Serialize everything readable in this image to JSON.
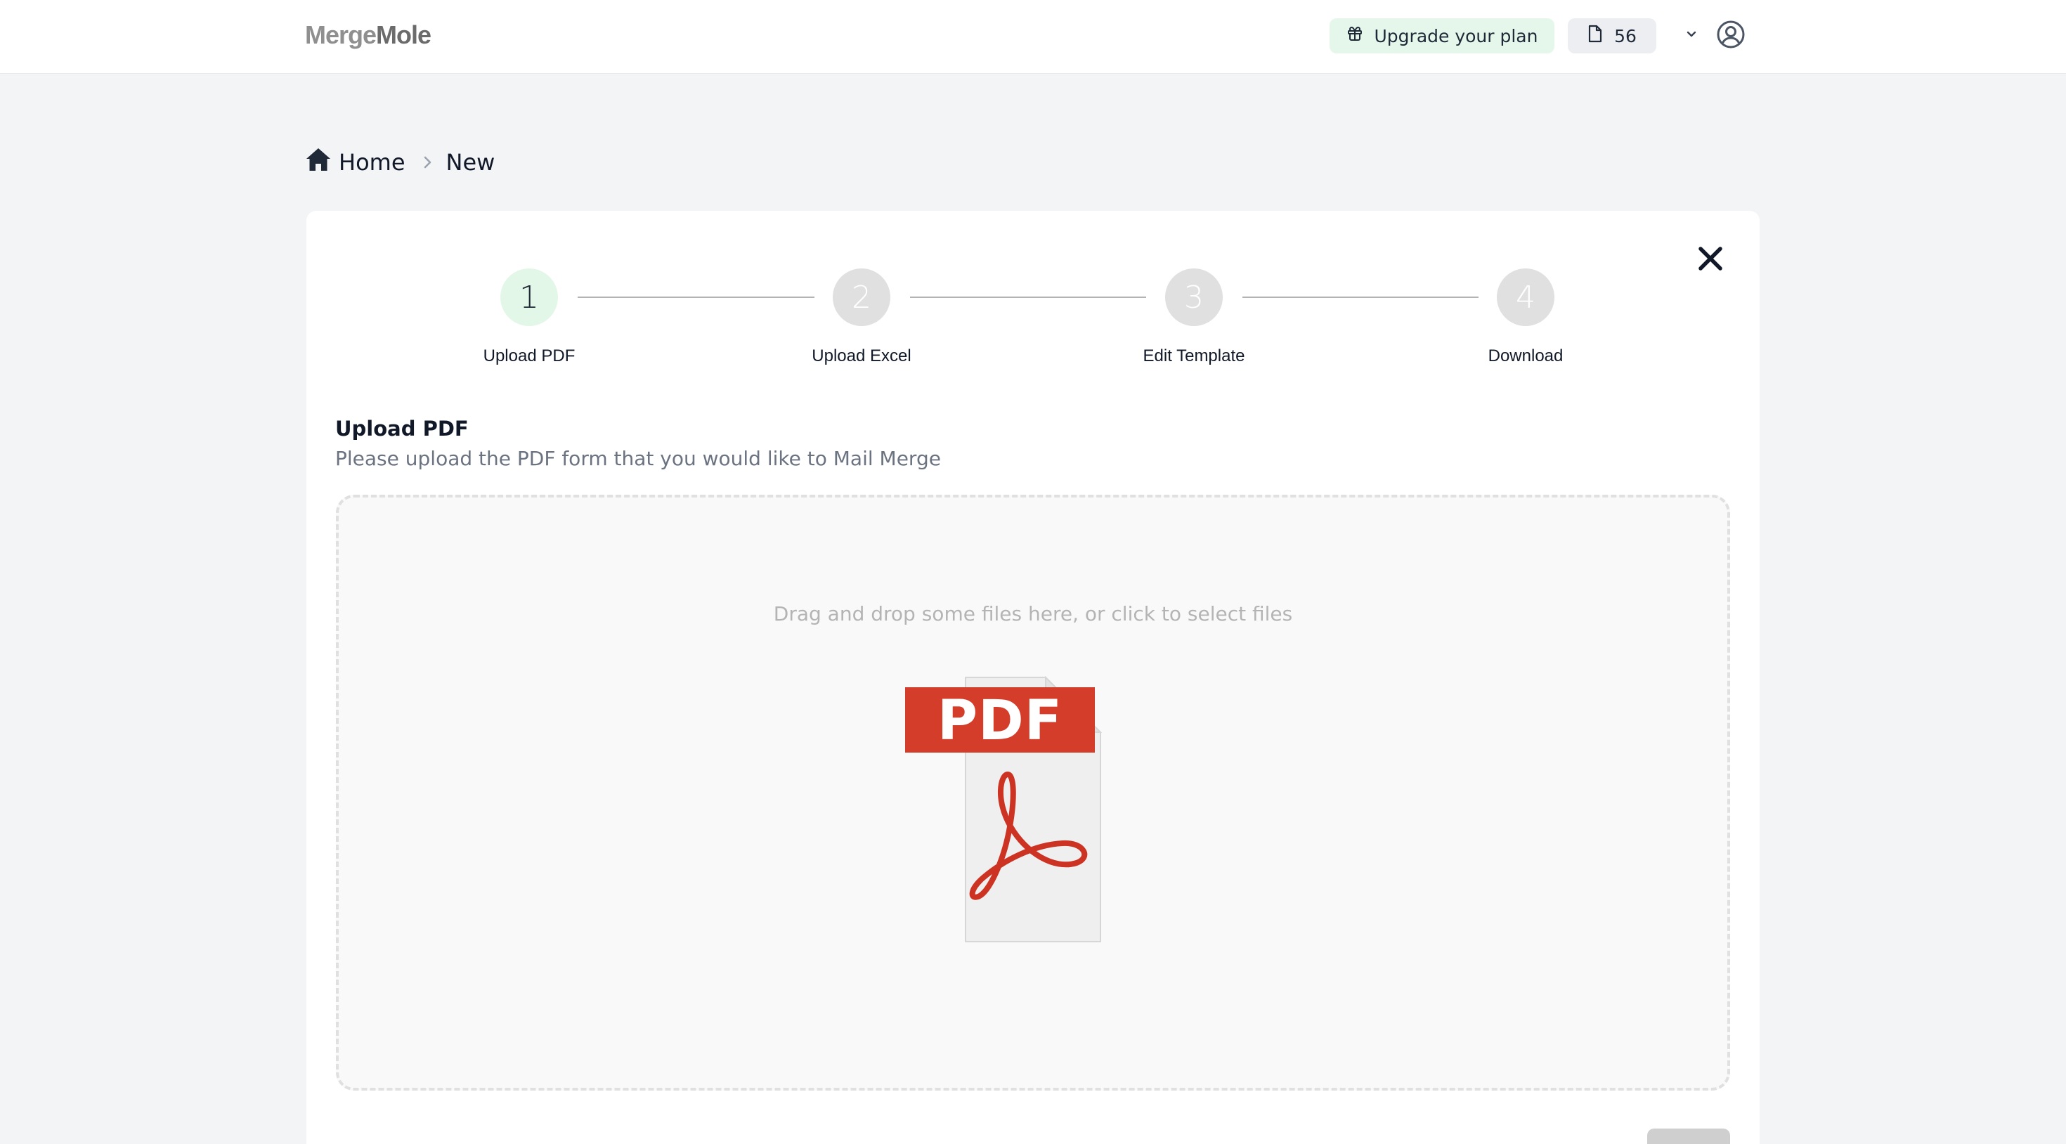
{
  "header": {
    "logo_part1": "Merge",
    "logo_part2": "Mole",
    "upgrade_label": "Upgrade your plan",
    "credits_count": "56"
  },
  "breadcrumb": {
    "home": "Home",
    "current": "New"
  },
  "stepper": {
    "steps": [
      {
        "number": "1",
        "label": "Upload PDF",
        "state": "active"
      },
      {
        "number": "2",
        "label": "Upload Excel",
        "state": "pending"
      },
      {
        "number": "3",
        "label": "Edit Template",
        "state": "pending"
      },
      {
        "number": "4",
        "label": "Download",
        "state": "pending"
      }
    ]
  },
  "upload": {
    "title": "Upload PDF",
    "description": "Please upload the PDF form that you would like to Mail Merge",
    "dropzone_hint": "Drag and drop some files here, or click to select files",
    "pdf_icon_text": "PDF"
  },
  "icons": {
    "upgrade": "gift-icon",
    "credits": "document-icon",
    "menu": "chevron-down-icon",
    "user": "user-circle-icon",
    "home": "home-icon",
    "separator": "chevron-right-icon",
    "close": "close-icon",
    "file": "pdf-file-icon"
  },
  "colors": {
    "accent_green_bg": "#e4f7ea",
    "active_step_bg": "#e3f7e9",
    "pending_step_bg": "#e0e0e0",
    "pdf_red": "#d33d2a",
    "page_bg": "#f3f4f6"
  }
}
